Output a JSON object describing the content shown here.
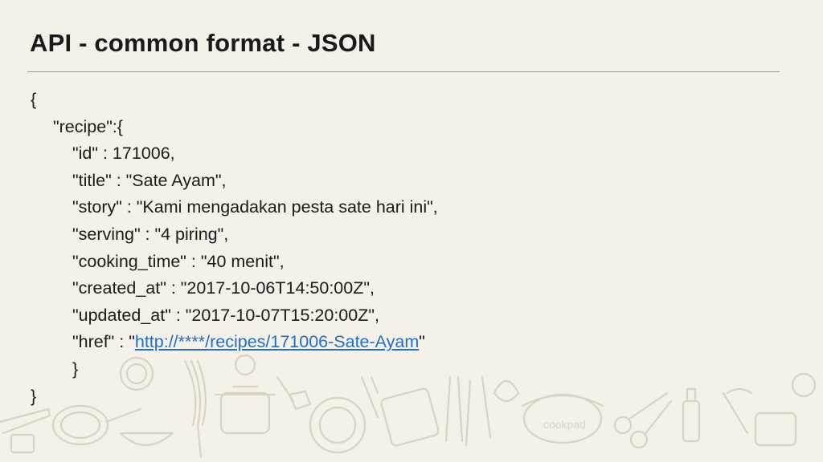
{
  "slide": {
    "title": "API - common format - JSON",
    "code": {
      "open_brace": "{",
      "recipe_key": "\"recipe\":{",
      "id_line": "\"id\" : 171006,",
      "title_line": "\"title\" : \"Sate Ayam\",",
      "story_line": "\"story\" : \"Kami mengadakan pesta sate hari ini\",",
      "serving_line": "\"serving\" : \"4 piring\",",
      "cooking_time_line": "\"cooking_time\" : \"40 menit\",",
      "created_at_line": "\"created_at\" : \"2017-10-06T14:50:00Z\",",
      "updated_at_line": "\"updated_at\" : \"2017-10-07T15:20:00Z\",",
      "href_prefix": "\"href\" : \"",
      "href_url": "http://****/recipes/171006-Sate-Ayam",
      "href_suffix": "\"",
      "inner_close": "}",
      "outer_close": "}"
    },
    "footer_logo_text": "cookpad",
    "colors": {
      "background": "#f5f1e8",
      "text": "#1a1a1a",
      "link": "#1f6fc4",
      "doodle": "#d9d3c6"
    }
  }
}
